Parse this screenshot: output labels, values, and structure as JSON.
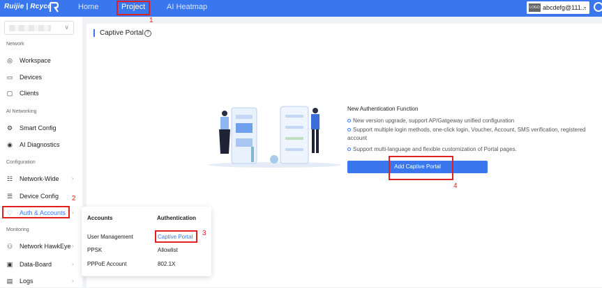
{
  "header": {
    "brand": "Ruijie | Rcycc",
    "nav": [
      "Home",
      "Project",
      "AI Heatmap"
    ],
    "account_logo": "LOGO",
    "account_name": "abcdefg@111...",
    "account_chevron": "⌄"
  },
  "sidebar": {
    "sections": {
      "network": "Network",
      "ai_networking": "AI Networking",
      "configuration": "Configuration",
      "monitoring": "Monitoring"
    },
    "items": [
      {
        "label": "Workspace",
        "icon": "target-icon"
      },
      {
        "label": "Devices",
        "icon": "device-icon"
      },
      {
        "label": "Clients",
        "icon": "client-icon"
      },
      {
        "label": "Smart Config",
        "icon": "smart-config-icon"
      },
      {
        "label": "AI Diagnostics",
        "icon": "diagnostics-icon"
      },
      {
        "label": "Network-Wide",
        "icon": "network-wide-icon"
      },
      {
        "label": "Device Config",
        "icon": "device-config-icon"
      },
      {
        "label": "Auth & Accounts",
        "icon": "shield-icon"
      },
      {
        "label": "Network HawkEye",
        "icon": "hawkeye-icon"
      },
      {
        "label": "Data-Board",
        "icon": "dashboard-icon"
      },
      {
        "label": "Logs",
        "icon": "logs-icon"
      }
    ]
  },
  "popover": {
    "accounts_header": "Accounts",
    "auth_header": "Authentication",
    "accounts": [
      "User Management",
      "PPSK",
      "PPPoE Account"
    ],
    "auth": [
      "Captive Portal",
      "Allowlist",
      "802.1X"
    ]
  },
  "main": {
    "title": "Captive Portal",
    "feature_title": "New Authentication Function",
    "features": [
      "New version upgrade, support AP/Gatgeway unified configuration",
      "Support multiple login methods, one-click login, Voucher, Account, SMS verification, registered account",
      "Support multi-language and flexible customization of Portal pages."
    ],
    "button": "Add Captive Portal"
  },
  "annotations": [
    "1",
    "2",
    "3",
    "4"
  ],
  "colors": {
    "accent": "#3a77ef",
    "annotation": "#e02020"
  }
}
